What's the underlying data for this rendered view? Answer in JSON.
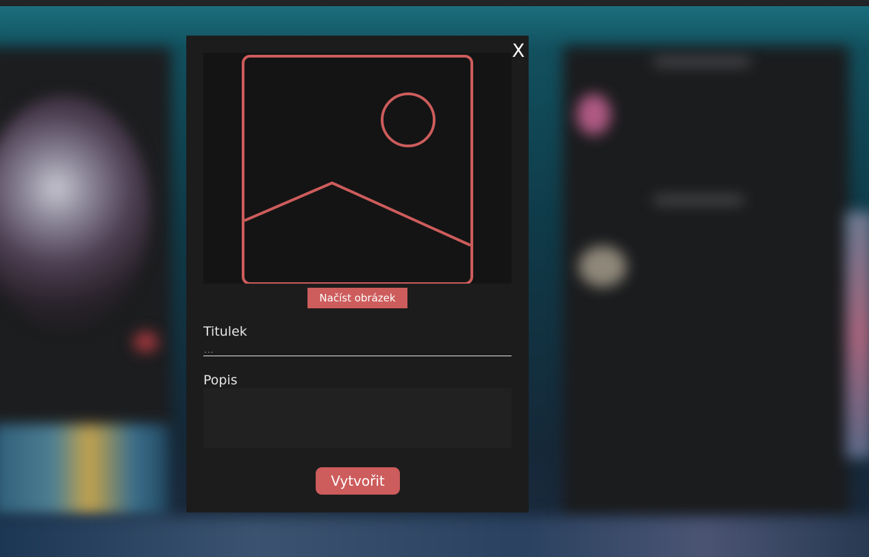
{
  "colors": {
    "accent": "#cd5c5c",
    "modal_background": "#1c1c1c",
    "preview_background": "#141414",
    "textarea_background": "#212121"
  },
  "modal": {
    "close_label": "X",
    "image_placeholder_icon": "image-placeholder-icon",
    "load_image_label": "Načíst obrázek",
    "title_label": "Titulek",
    "title_input": {
      "value": "",
      "placeholder": "..."
    },
    "description_label": "Popis",
    "description_input": {
      "value": "",
      "placeholder": ""
    },
    "create_label": "Vytvořit"
  }
}
